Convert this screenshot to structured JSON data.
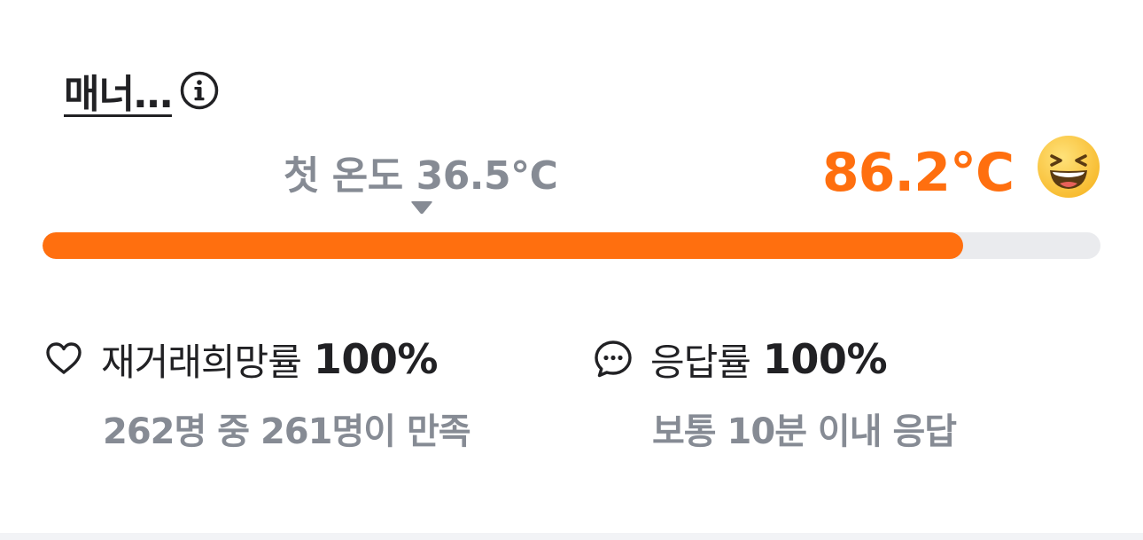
{
  "manner": {
    "title": "매너…",
    "info_icon": "info-circle-icon"
  },
  "temperature": {
    "first_label": "첫 온도 36.5°C",
    "current": "86.2°C",
    "current_value": 86.2,
    "fill_fraction": 0.87,
    "emoji": "laughing-face-icon"
  },
  "stats": {
    "rehire": {
      "icon": "heart-outline-icon",
      "label": "재거래희망률",
      "value": "100%",
      "sub": "262명 중 261명이 만족"
    },
    "response": {
      "icon": "chat-bubble-icon",
      "label": "응답률",
      "value": "100%",
      "sub": "보통 10분 이내 응답"
    }
  },
  "colors": {
    "accent": "#ff6f0f",
    "track": "#eaebee",
    "muted_text": "#868b94",
    "primary_text": "#212124"
  }
}
